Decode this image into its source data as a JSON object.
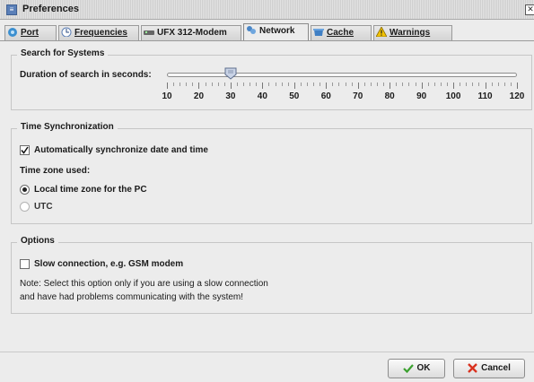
{
  "window": {
    "title": "Preferences",
    "icon": "preferences-app-icon",
    "close_icon": "close-icon"
  },
  "tabs": [
    {
      "label": "Port",
      "icon": "port-icon"
    },
    {
      "label": "Frequencies",
      "icon": "frequencies-icon"
    },
    {
      "label": "UFX 312-Modem",
      "icon": "modem-icon"
    },
    {
      "label": "Network",
      "icon": "network-icon",
      "active": true
    },
    {
      "label": "Cache",
      "icon": "cache-icon"
    },
    {
      "label": "Warnings",
      "icon": "warning-icon"
    }
  ],
  "search": {
    "group_title": "Search for Systems",
    "slider_label": "Duration of search in seconds:",
    "min": 10,
    "max": 120,
    "value": 30,
    "tick_labels": [
      "10",
      "20",
      "30",
      "40",
      "50",
      "60",
      "70",
      "80",
      "90",
      "100",
      "110",
      "120"
    ]
  },
  "time_sync": {
    "group_title": "Time Synchronization",
    "auto_sync_label": "Automatically synchronize date and time",
    "auto_sync_checked": true,
    "timezone_label": "Time zone used:",
    "local_label": "Local time zone for the PC",
    "local_selected": true,
    "utc_label": "UTC",
    "utc_selected": false
  },
  "options": {
    "group_title": "Options",
    "slow_label": "Slow connection, e.g. GSM modem",
    "slow_checked": false,
    "note_line1": "Note: Select this option only if you are using a slow connection",
    "note_line2": "and have had problems communicating with the system!"
  },
  "buttons": {
    "ok_label": "OK",
    "cancel_label": "Cancel"
  },
  "colors": {
    "ok_check": "#3aa02e",
    "cancel_x": "#d9321f"
  }
}
